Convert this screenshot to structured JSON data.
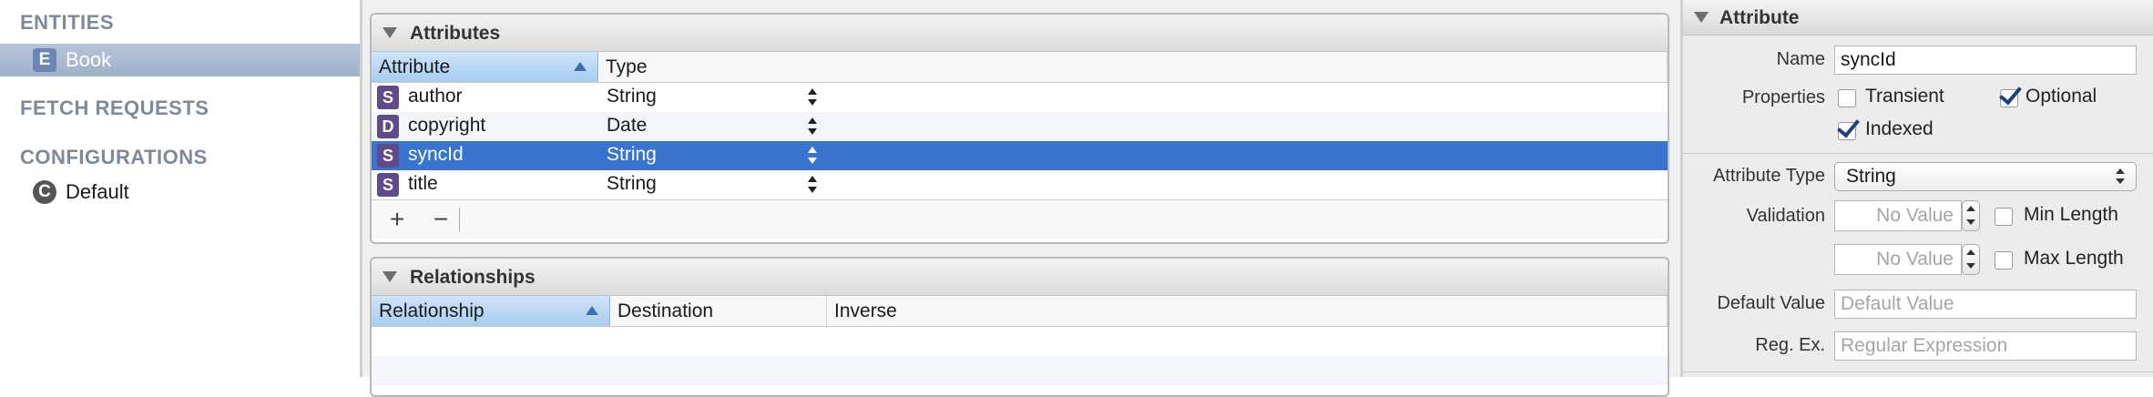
{
  "sidebar": {
    "entities_heading": "ENTITIES",
    "entities": [
      {
        "badge": "E",
        "name": "Book"
      }
    ],
    "fetch_requests_heading": "FETCH REQUESTS",
    "configurations_heading": "CONFIGURATIONS",
    "configurations": [
      {
        "icon": "C",
        "name": "Default"
      }
    ]
  },
  "attributes_panel": {
    "title": "Attributes",
    "columns": {
      "attribute": "Attribute",
      "type": "Type"
    },
    "rows": [
      {
        "badge": "S",
        "name": "author",
        "type": "String"
      },
      {
        "badge": "D",
        "name": "copyright",
        "type": "Date"
      },
      {
        "badge": "S",
        "name": "syncId",
        "type": "String"
      },
      {
        "badge": "S",
        "name": "title",
        "type": "String"
      }
    ],
    "add_button": "+",
    "remove_button": "−"
  },
  "relationships_panel": {
    "title": "Relationships",
    "columns": {
      "relationship": "Relationship",
      "destination": "Destination",
      "inverse": "Inverse"
    }
  },
  "inspector": {
    "title": "Attribute",
    "name_label": "Name",
    "name_value": "syncId",
    "properties_label": "Properties",
    "transient_label": "Transient",
    "transient_checked": false,
    "optional_label": "Optional",
    "optional_checked": true,
    "indexed_label": "Indexed",
    "indexed_checked": true,
    "attribute_type_label": "Attribute Type",
    "attribute_type_value": "String",
    "validation_label": "Validation",
    "min_placeholder": "No Value",
    "min_length_label": "Min Length",
    "max_placeholder": "No Value",
    "max_length_label": "Max Length",
    "default_value_label": "Default Value",
    "default_value_placeholder": "Default Value",
    "regex_label": "Reg. Ex.",
    "regex_placeholder": "Regular Expression"
  },
  "colors": {
    "selection": "#3874d0",
    "entity_selection": "#a9b9d1",
    "section_heading": "#7c8a99",
    "sorted_header": "#b9d8f5"
  },
  "icons": {
    "entity": "entity-icon",
    "string_type": "string-type-icon",
    "date_type": "date-type-icon",
    "configuration": "configuration-icon",
    "disclosure": "disclosure-triangle-icon",
    "checkmark": "checkmark-icon"
  }
}
